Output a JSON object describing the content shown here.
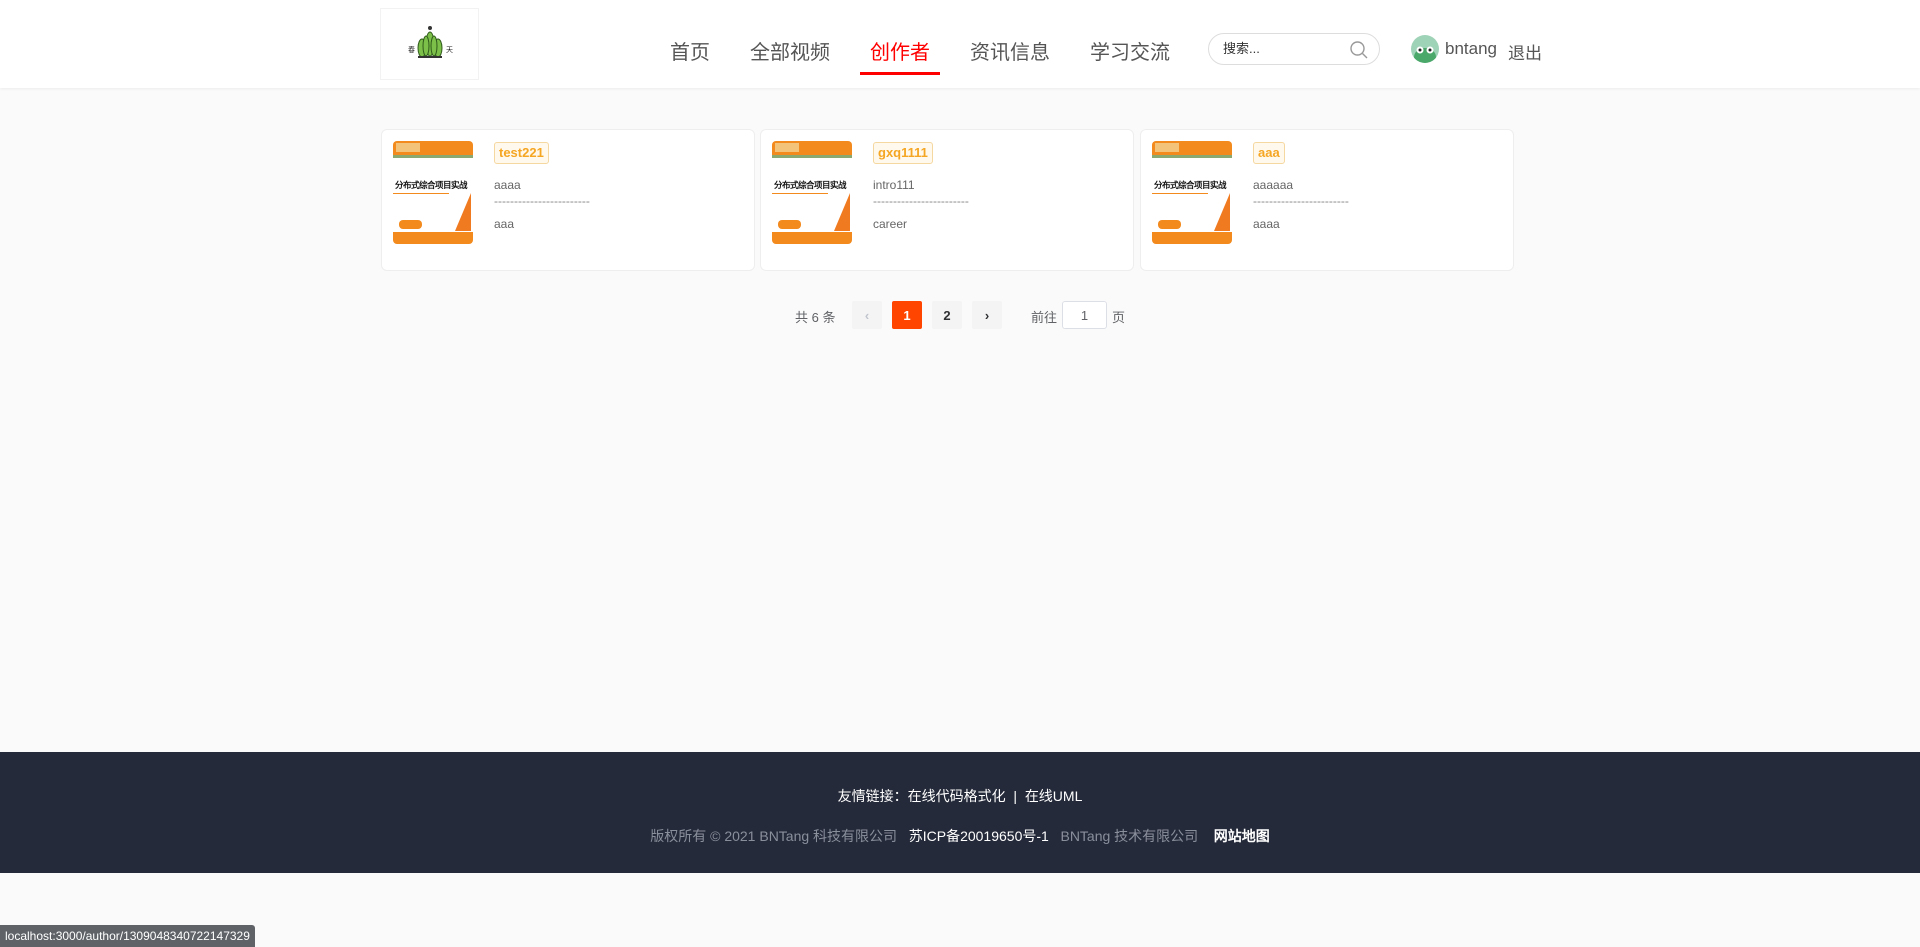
{
  "header": {
    "nav": [
      {
        "label": "首页"
      },
      {
        "label": "全部视频"
      },
      {
        "label": "创作者",
        "active": true
      },
      {
        "label": "资讯信息"
      },
      {
        "label": "学习交流"
      }
    ],
    "search_placeholder": "搜索...",
    "username": "bntang",
    "logout": "退出",
    "accent": "#ff0000"
  },
  "cards": [
    {
      "name": "test221",
      "intro": "aaaa",
      "divider": "------------------------",
      "career": "aaa",
      "cover_title": "分布式综合项目实战"
    },
    {
      "name": "gxq1111",
      "intro": "intro111",
      "divider": "------------------------",
      "career": "career",
      "cover_title": "分布式综合项目实战"
    },
    {
      "name": "aaa",
      "intro": "aaaaaa",
      "divider": "------------------------",
      "career": "aaaa",
      "cover_title": "分布式综合项目实战"
    }
  ],
  "pagination": {
    "total": "共 6 条",
    "pages": [
      "1",
      "2"
    ],
    "current": "1",
    "goto_prefix": "前往",
    "goto_value": "1",
    "goto_suffix": "页",
    "active_color": "#ff4500"
  },
  "footer": {
    "links_label": "友情链接：",
    "link1": "在线代码格式化",
    "sep": "|",
    "link2": "在线UML",
    "copyright": "版权所有 © 2021 BNTang 科技有限公司",
    "icp": "苏ICP备20019650号-1",
    "company": "BNTang 技术有限公司",
    "sitemap": "网站地图"
  },
  "status_bar": "localhost:3000/author/1309048340722147329"
}
